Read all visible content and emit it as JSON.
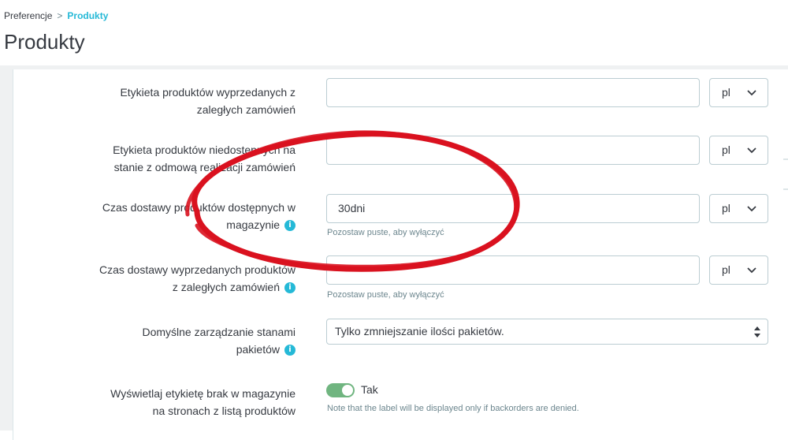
{
  "breadcrumb": {
    "parent": "Preferencje",
    "separator": ">",
    "current": "Produkty"
  },
  "page_title": "Produkty",
  "fields": [
    {
      "label_line1": "Etykieta produktów wyprzedanych z",
      "label_line2": "zaległych zamówień",
      "value": "",
      "lang": "pl"
    },
    {
      "label_line1": "Etykieta produktów niedostępnych na",
      "label_line2": "stanie z odmową realizacji zamówień",
      "value": "",
      "lang": "pl"
    },
    {
      "label_line1": "Czas dostawy produktów dostępnych w",
      "label_line2": "magazynie",
      "value": "30dni",
      "lang": "pl",
      "help": "Pozostaw puste, aby wyłączyć"
    },
    {
      "label_line1": "Czas dostawy wyprzedanych produktów",
      "label_line2": "z zaległych zamówień",
      "value": "",
      "lang": "pl",
      "help": "Pozostaw puste, aby wyłączyć"
    }
  ],
  "pack_stock": {
    "label_line1": "Domyślne zarządzanie stanami",
    "label_line2": "pakietów",
    "selected": "Tylko zmniejszanie ilości pakietów."
  },
  "out_of_stock_label": {
    "label_line1": "Wyświetlaj etykietę brak w magazynie",
    "label_line2": "na stronach z listą produktów",
    "toggle_label": "Tak",
    "toggle_on": true,
    "help": "Note that the label will be displayed only if backorders are denied."
  },
  "colors": {
    "accent": "#25b9d7",
    "toggle_on": "#70b580",
    "annotation": "#d9121f"
  }
}
